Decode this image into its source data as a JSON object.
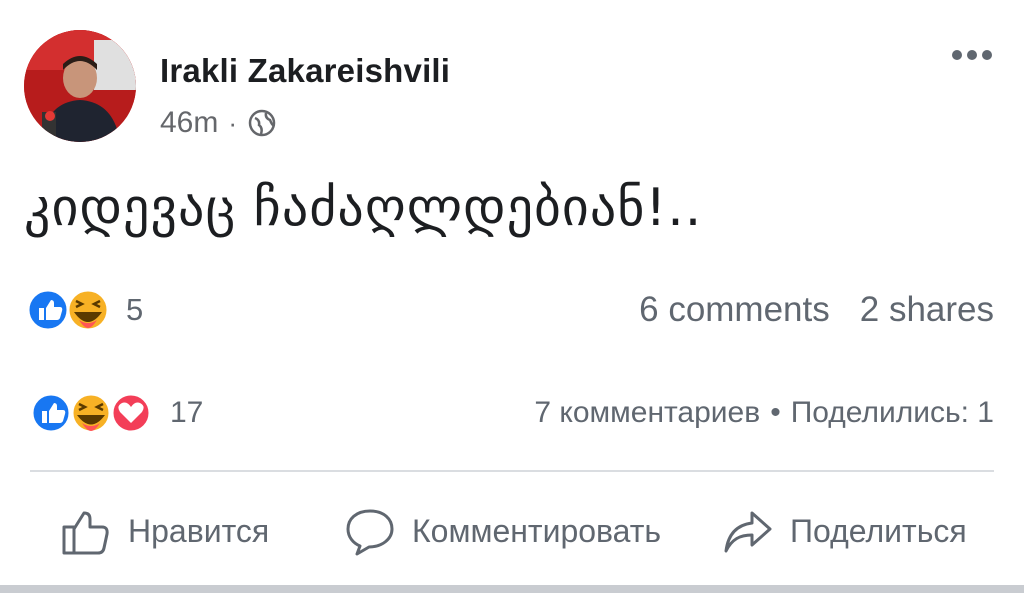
{
  "post": {
    "author": "Irakli Zakareishvili",
    "time": "46m",
    "separator": "·",
    "privacy_icon": "globe-icon",
    "more_icon": "more-options-icon",
    "text": "კიდევაც ჩაძაღლდებიან!.."
  },
  "original_stats": {
    "reaction_icons": [
      "like-icon",
      "haha-icon"
    ],
    "reaction_count": "5",
    "comments": "6 comments",
    "shares": "2 shares"
  },
  "shared_stats": {
    "reaction_icons": [
      "like-icon",
      "haha-icon",
      "love-icon"
    ],
    "reaction_count": "17",
    "comments": "7 комментариев",
    "separator": "•",
    "shares": "Поделились: 1"
  },
  "actions": {
    "like": "Нравится",
    "comment": "Комментировать",
    "share": "Поделиться"
  },
  "colors": {
    "like_blue": "#1877f2",
    "haha_yellow": "#f7b125",
    "love_red": "#f33e58",
    "muted_text": "#606770"
  }
}
